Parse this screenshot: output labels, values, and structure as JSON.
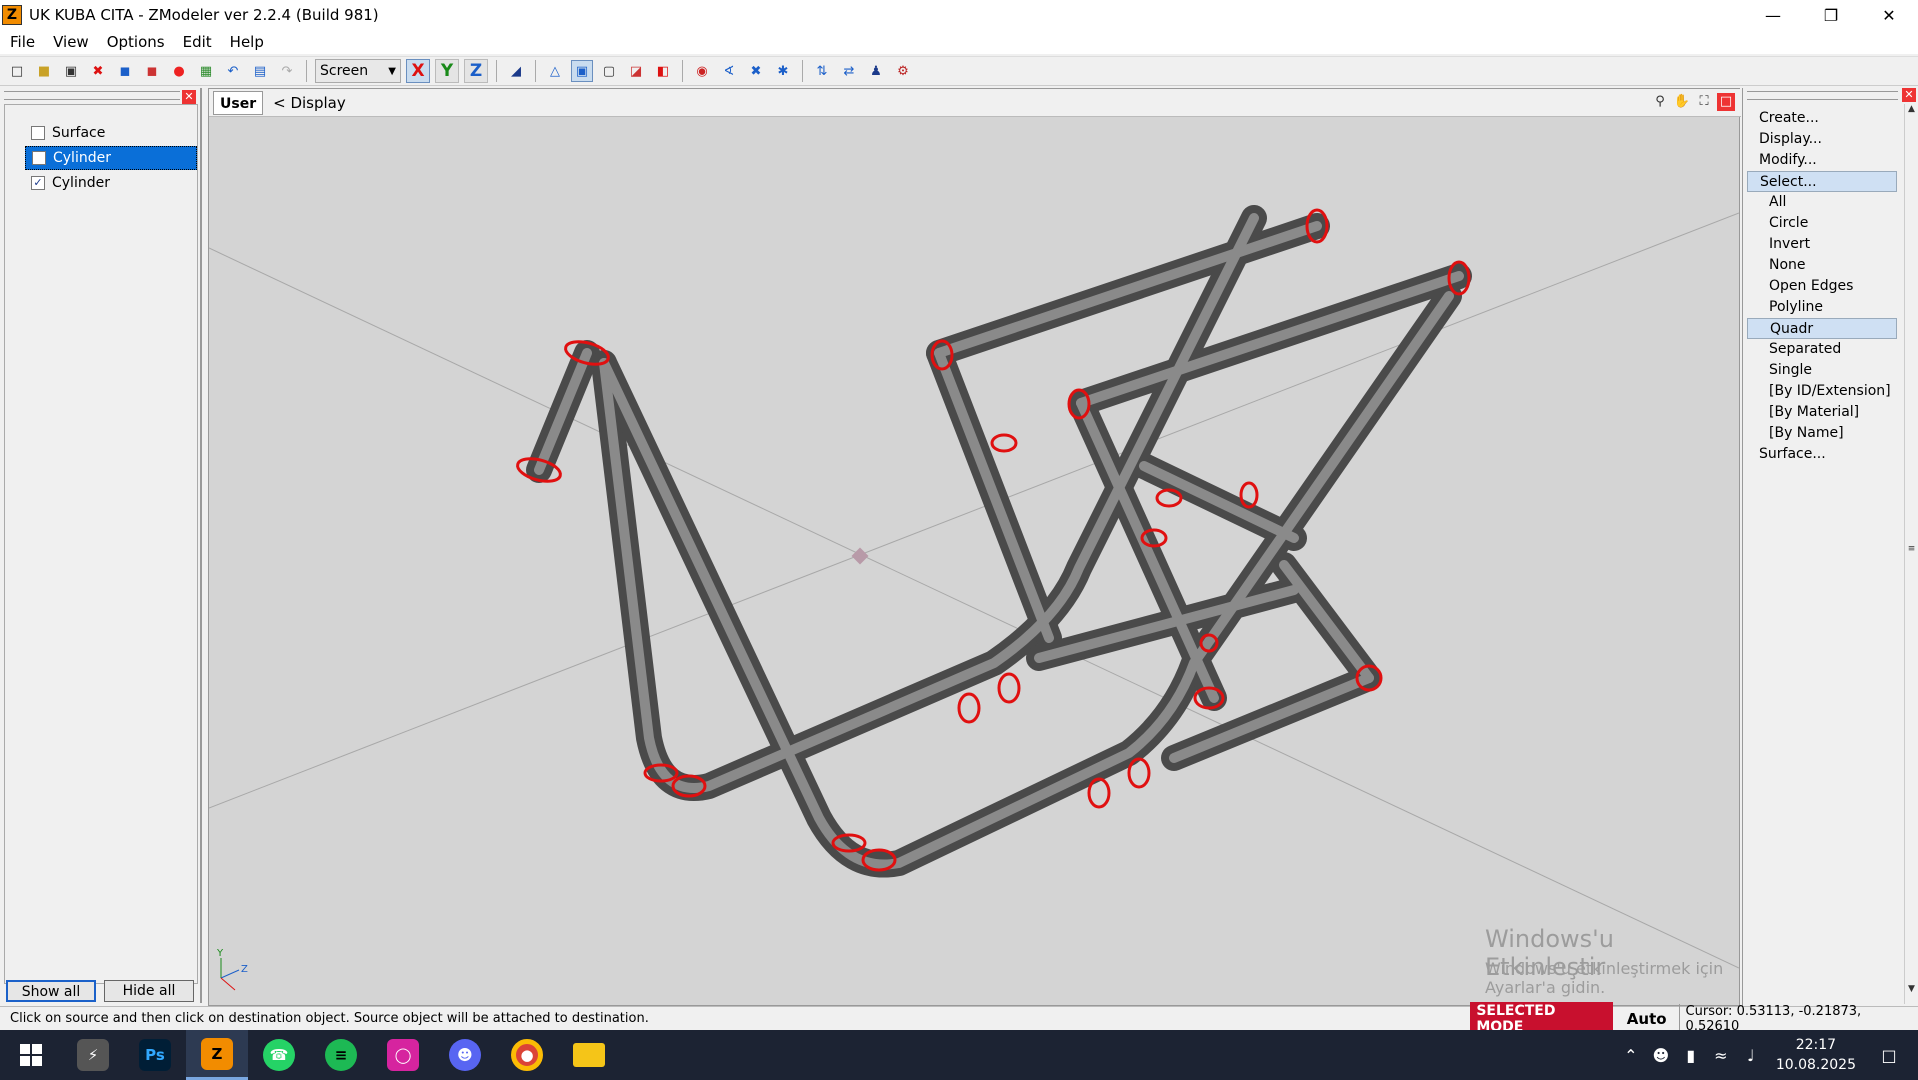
{
  "window": {
    "title": "UK KUBA CITA - ZModeler ver 2.2.4 (Build 981)",
    "app_icon": "Z"
  },
  "menu": [
    "File",
    "View",
    "Options",
    "Edit",
    "Help"
  ],
  "toolbar": {
    "coord_mode": "Screen",
    "axis_x": "X",
    "axis_y": "Y",
    "axis_z": "Z"
  },
  "objects": {
    "items": [
      {
        "label": "Surface",
        "checked": false,
        "selected": false
      },
      {
        "label": "Cylinder",
        "checked": false,
        "selected": true
      },
      {
        "label": "Cylinder",
        "checked": true,
        "selected": false
      }
    ],
    "show_all": "Show all",
    "hide_all": "Hide all"
  },
  "viewport": {
    "tab": "User",
    "display": "< Display",
    "axis_y": "Y",
    "axis_z": "Z"
  },
  "commands": {
    "create": "Create...",
    "display": "Display...",
    "modify": "Modify...",
    "select": "Select...",
    "select_items": [
      "All",
      "Circle",
      "Invert",
      "None",
      "Open Edges",
      "Polyline",
      "Quadr",
      "Separated",
      "Single",
      "[By ID/Extension]",
      "[By Material]",
      "[By Name]"
    ],
    "surface": "Surface..."
  },
  "watermark": {
    "line1": "Windows'u Etkinleştir",
    "line2": "Windows'u etkinleştirmek için Ayarlar'a gidin."
  },
  "status": {
    "message": "Click on source and then click on destination object. Source object will be attached to destination.",
    "mode": "SELECTED MODE",
    "auto": "Auto",
    "cursor": "Cursor: 0.53113, -0.21873, 0.52610"
  },
  "taskbar": {
    "apps": [
      "start",
      "app-launcher",
      "Ps",
      "Z",
      "whatsapp",
      "spotify",
      "instagram",
      "discord",
      "chrome",
      "explorer"
    ],
    "time": "22:17",
    "date": "10.08.2025"
  },
  "colors": {
    "selection": "#0a6fd8",
    "selected_mode": "#c8102e",
    "taskbar": "#1c2333",
    "viewport": "#d4d4d4"
  }
}
